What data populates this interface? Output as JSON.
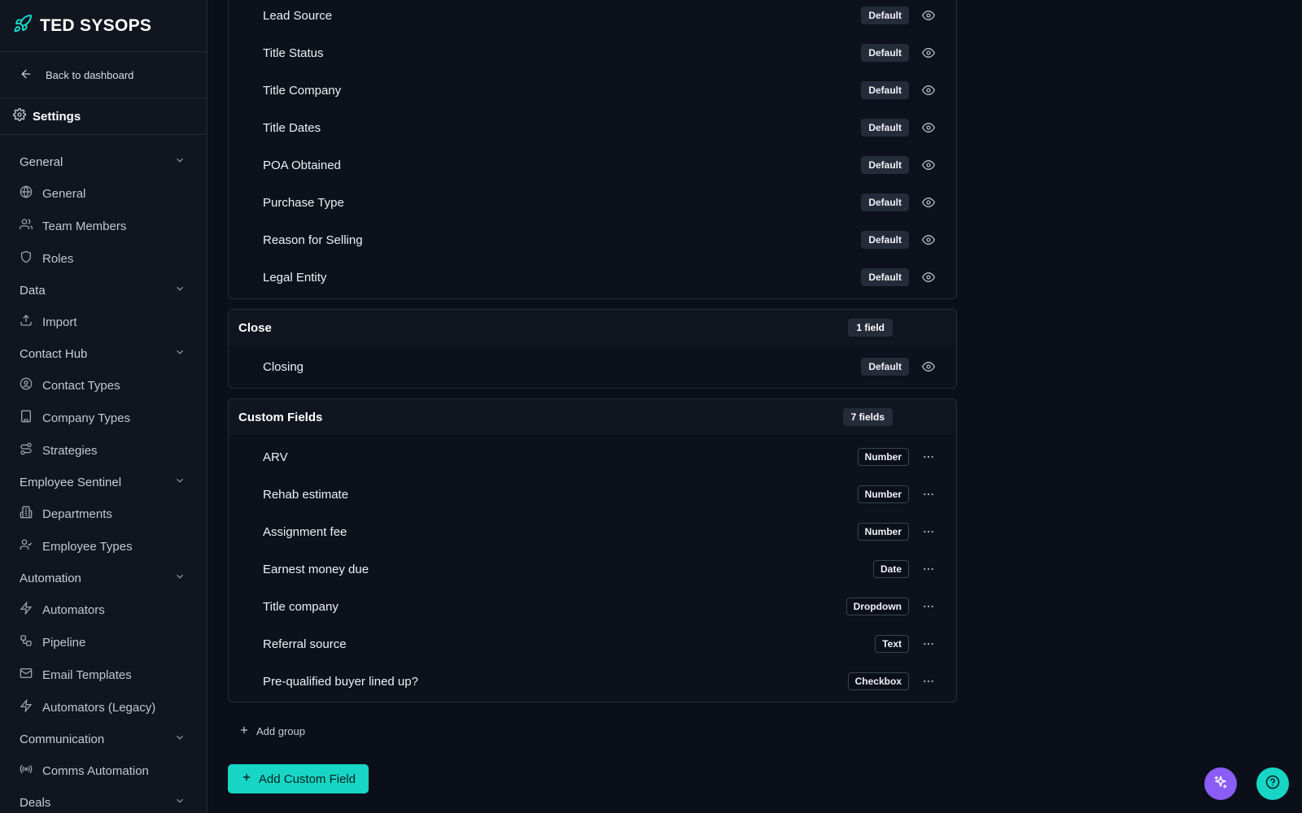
{
  "brand": {
    "name": "TED SYSOPS",
    "accent": "#17d6c6"
  },
  "sidebar": {
    "back_label": "Back to dashboard",
    "settings_label": "Settings",
    "groups": [
      {
        "label": "General",
        "items": [
          {
            "label": "General",
            "icon": "globe-icon"
          },
          {
            "label": "Team Members",
            "icon": "users-icon"
          },
          {
            "label": "Roles",
            "icon": "shield-icon"
          }
        ]
      },
      {
        "label": "Data",
        "items": [
          {
            "label": "Import",
            "icon": "upload-icon"
          }
        ]
      },
      {
        "label": "Contact Hub",
        "items": [
          {
            "label": "Contact Types",
            "icon": "user-circle-icon"
          },
          {
            "label": "Company Types",
            "icon": "building-icon"
          },
          {
            "label": "Strategies",
            "icon": "route-icon"
          }
        ]
      },
      {
        "label": "Employee Sentinel",
        "items": [
          {
            "label": "Departments",
            "icon": "building-2-icon"
          },
          {
            "label": "Employee Types",
            "icon": "user-check-icon"
          }
        ]
      },
      {
        "label": "Automation",
        "items": [
          {
            "label": "Automators",
            "icon": "zap-icon"
          },
          {
            "label": "Pipeline",
            "icon": "workflow-icon"
          },
          {
            "label": "Email Templates",
            "icon": "mail-icon"
          },
          {
            "label": "Automators (Legacy)",
            "icon": "zap-icon"
          }
        ]
      },
      {
        "label": "Communication",
        "items": [
          {
            "label": "Comms Automation",
            "icon": "radio-icon"
          }
        ]
      },
      {
        "label": "Deals",
        "items": []
      }
    ]
  },
  "sections": {
    "top": {
      "fields": [
        {
          "name": "Lead Source",
          "badge": "Default"
        },
        {
          "name": "Title Status",
          "badge": "Default"
        },
        {
          "name": "Title Company",
          "badge": "Default"
        },
        {
          "name": "Title Dates",
          "badge": "Default"
        },
        {
          "name": "POA Obtained",
          "badge": "Default"
        },
        {
          "name": "Purchase Type",
          "badge": "Default"
        },
        {
          "name": "Reason for Selling",
          "badge": "Default"
        },
        {
          "name": "Legal Entity",
          "badge": "Default"
        }
      ]
    },
    "close": {
      "title": "Close",
      "count": "1 field",
      "fields": [
        {
          "name": "Closing",
          "badge": "Default"
        }
      ]
    },
    "custom": {
      "title": "Custom Fields",
      "count": "7 fields",
      "fields": [
        {
          "name": "ARV",
          "type": "Number"
        },
        {
          "name": "Rehab estimate",
          "type": "Number"
        },
        {
          "name": "Assignment fee",
          "type": "Number"
        },
        {
          "name": "Earnest money due",
          "type": "Date"
        },
        {
          "name": "Title company",
          "type": "Dropdown"
        },
        {
          "name": "Referral source",
          "type": "Text"
        },
        {
          "name": "Pre-qualified buyer lined up?",
          "type": "Checkbox"
        }
      ]
    }
  },
  "actions": {
    "add_group": "Add group",
    "add_custom_field": "Add Custom Field"
  },
  "colors": {
    "accent": "#17d6c6",
    "ai": "#8b5cf6"
  }
}
